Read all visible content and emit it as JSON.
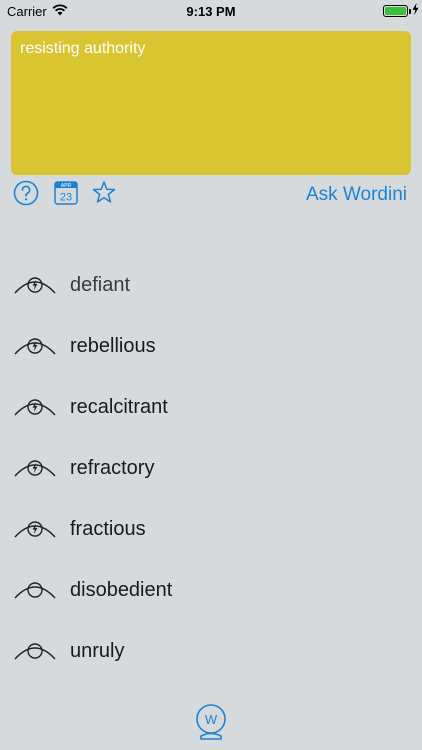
{
  "status_bar": {
    "carrier": "Carrier",
    "time": "9:13 PM",
    "battery_level": 1.0
  },
  "query": {
    "text": "resisting authority"
  },
  "toolbar": {
    "help_icon": "question-circle-icon",
    "calendar_icon": "calendar-icon",
    "calendar_month": "APR",
    "calendar_day": "23",
    "favorite_icon": "star-outline-icon",
    "ask_label": "Ask Wordini"
  },
  "results": [
    {
      "word": "defiant",
      "icon": "eye-bolt-icon"
    },
    {
      "word": "rebellious",
      "icon": "eye-bolt-icon"
    },
    {
      "word": "recalcitrant",
      "icon": "eye-bolt-icon"
    },
    {
      "word": "refractory",
      "icon": "eye-bolt-icon"
    },
    {
      "word": "fractious",
      "icon": "eye-bolt-icon"
    },
    {
      "word": "disobedient",
      "icon": "eye-icon"
    },
    {
      "word": "unruly",
      "icon": "eye-icon"
    }
  ],
  "bottom": {
    "icon": "wordini-crystal-ball-icon",
    "letter": "W"
  },
  "colors": {
    "background": "#d6dadd",
    "query_box": "#d9c531",
    "accent": "#1e82d4",
    "battery": "#39c239"
  }
}
